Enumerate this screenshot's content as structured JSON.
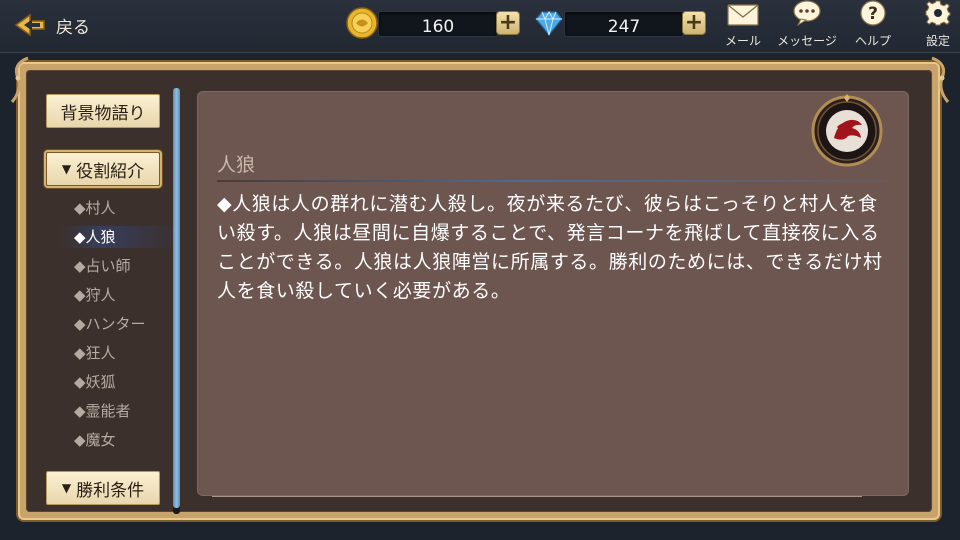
{
  "header": {
    "back_label": "戻る",
    "coins": {
      "value": "160",
      "icon": "gold-coin-icon"
    },
    "gems": {
      "value": "247",
      "icon": "diamond-icon"
    },
    "plus_label": "+",
    "icons": {
      "mail": {
        "label": "メール",
        "icon": "envelope-icon"
      },
      "message": {
        "label": "メッセージ",
        "icon": "speech-bubble-icon"
      },
      "help": {
        "label": "ヘルプ",
        "icon": "question-icon"
      },
      "settings": {
        "label": "設定",
        "icon": "gear-icon"
      }
    }
  },
  "sidebar": {
    "background_story": "背景物語り",
    "roles_section": {
      "label": "役割紹介",
      "expanded": true
    },
    "roles": [
      {
        "label": "◆村人",
        "selected": false
      },
      {
        "label": "◆人狼",
        "selected": true
      },
      {
        "label": "◆占い師",
        "selected": false
      },
      {
        "label": "◆狩人",
        "selected": false
      },
      {
        "label": "◆ハンター",
        "selected": false
      },
      {
        "label": "◆狂人",
        "selected": false
      },
      {
        "label": "◆妖狐",
        "selected": false
      },
      {
        "label": "◆霊能者",
        "selected": false
      },
      {
        "label": "◆魔女",
        "selected": false
      }
    ],
    "win_conditions": "勝利条件"
  },
  "content": {
    "title": "人狼",
    "body": "◆人狼は人の群れに潜む人殺し。夜が来るたび、彼らはこっそりと村人を食い殺す。人狼は昼間に自爆することで、発言コーナを飛ばして直接夜に入ることができる。人狼は人狼陣営に所属する。勝利のためには、できるだけ村人を食い殺していく必要がある。",
    "emblem_icon": "werewolf-faction-emblem-icon"
  },
  "colors": {
    "accent_gold": "#c9a46a",
    "panel": "#6d5550",
    "scroll_blue": "#8fc0e0"
  }
}
